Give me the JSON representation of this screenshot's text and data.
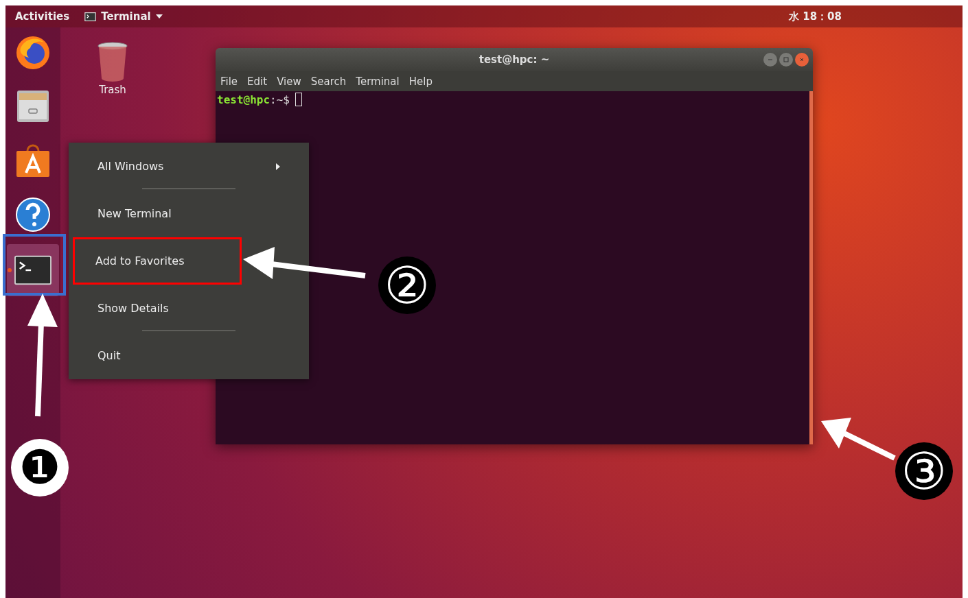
{
  "top_bar": {
    "activities": "Activities",
    "app_menu": "Terminal",
    "clock": "水 18：08"
  },
  "dock": [
    {
      "kind": "firefox",
      "selected": false,
      "running": false
    },
    {
      "kind": "files",
      "selected": false,
      "running": false
    },
    {
      "kind": "software",
      "selected": false,
      "running": false
    },
    {
      "kind": "help",
      "selected": false,
      "running": false
    },
    {
      "kind": "terminal",
      "selected": true,
      "running": true
    }
  ],
  "desktop_icons": [
    {
      "label": "Trash"
    }
  ],
  "terminal_window": {
    "title": "test@hpc: ~",
    "menu": [
      "File",
      "Edit",
      "View",
      "Search",
      "Terminal",
      "Help"
    ],
    "prompt_user": "test@hpc",
    "prompt_path": ":~$"
  },
  "context_menu": [
    {
      "label": "All Windows",
      "submenu": true,
      "separator_after": true,
      "highlighted": false
    },
    {
      "label": "New Terminal",
      "submenu": false,
      "separator_after": false,
      "highlighted": false
    },
    {
      "label": "Add to Favorites",
      "submenu": false,
      "separator_after": false,
      "highlighted": true
    },
    {
      "label": "Show Details",
      "submenu": false,
      "separator_after": true,
      "highlighted": false
    },
    {
      "label": "Quit",
      "submenu": false,
      "separator_after": false,
      "highlighted": false
    }
  ],
  "annotations": [
    {
      "label": "❶",
      "kind": "negative"
    },
    {
      "label": "②",
      "kind": "outlined"
    },
    {
      "label": "③",
      "kind": "outlined"
    }
  ]
}
